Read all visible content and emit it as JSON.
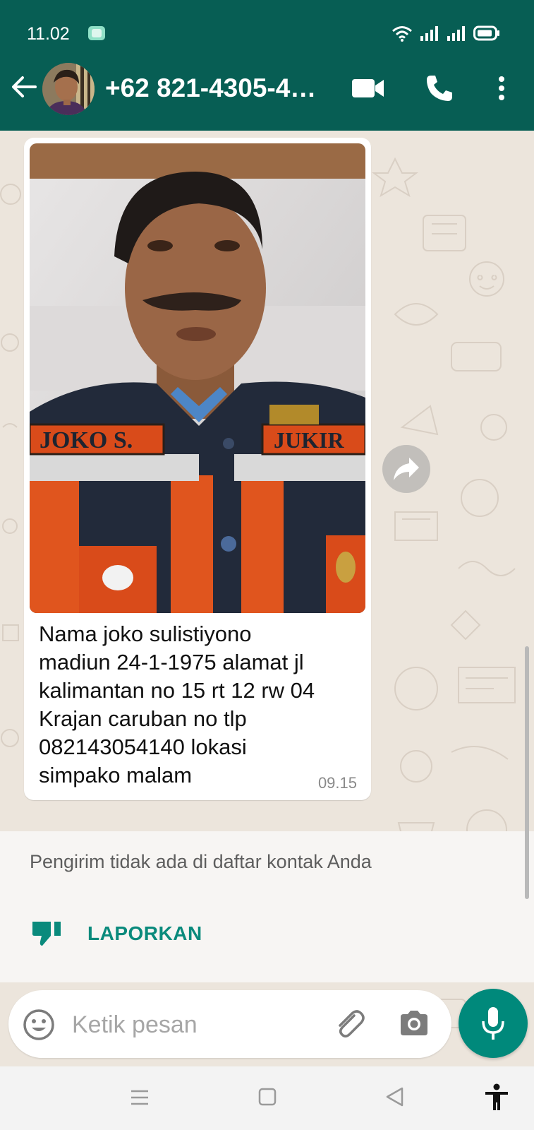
{
  "status_bar": {
    "time": "11.02"
  },
  "header": {
    "contact_title": "+62 821-4305-4…",
    "icons": [
      "back-arrow-icon",
      "contact-avatar",
      "video-call-icon",
      "phone-call-icon",
      "more-vert-icon"
    ]
  },
  "message": {
    "caption": "Nama joko sulistiyono\nmadiun 24-1-1975 alamat jl\nkalimantan no 15 rt 12 rw 04\nKrajan caruban no tlp\n082143054140 lokasi\nsimpako malam",
    "time": "09.15",
    "photo_badges": [
      "JOKO S.",
      "JUKIR"
    ]
  },
  "unknown_sender": {
    "notice": "Pengirim tidak ada di daftar kontak Anda",
    "report_label": "LAPORKAN"
  },
  "composer": {
    "placeholder": "Ketik pesan"
  },
  "colors": {
    "header": "#075e54",
    "accent": "#00897b",
    "report_text": "#0a8a7c",
    "chat_background": "#ece5dc"
  }
}
